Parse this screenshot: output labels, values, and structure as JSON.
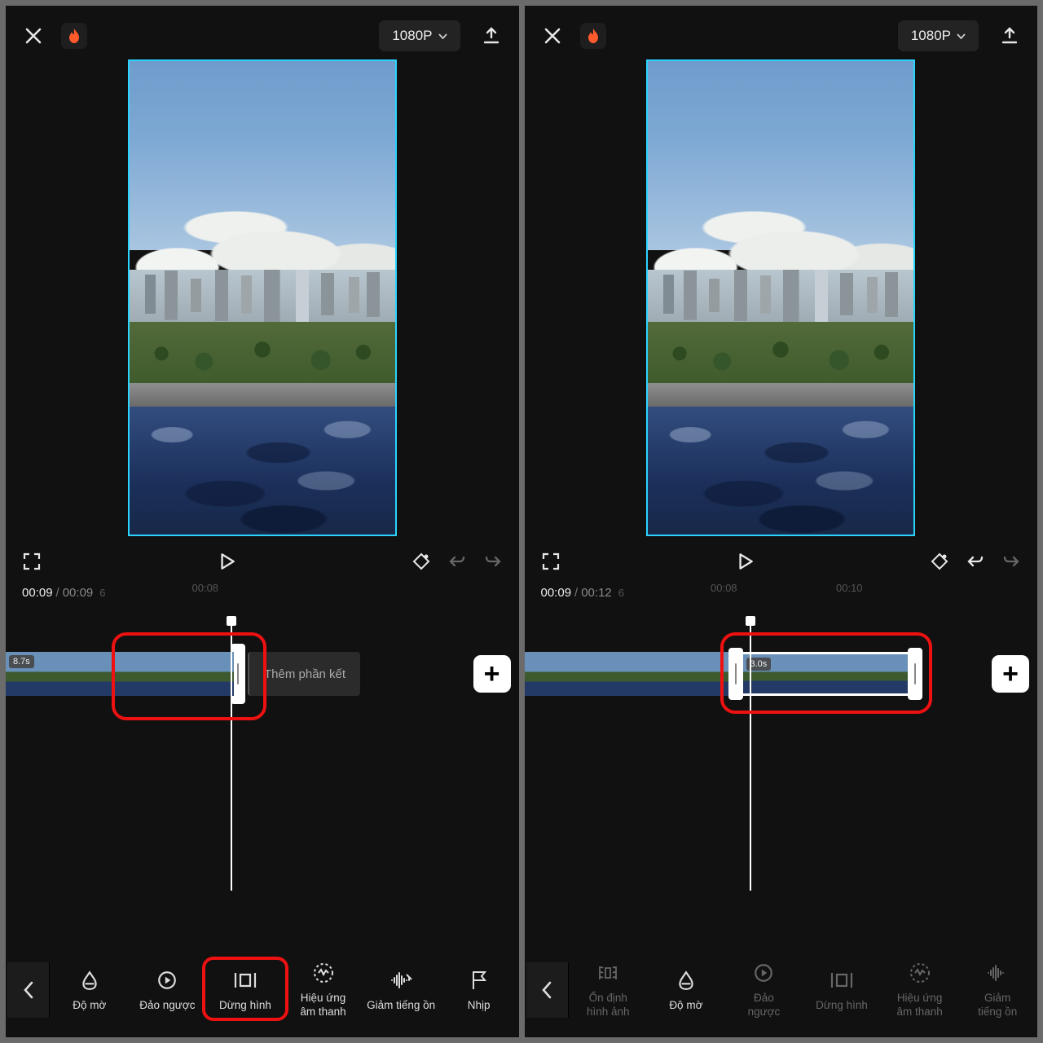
{
  "left": {
    "resolution": "1080P",
    "time_current": "00:09",
    "time_total": "00:09",
    "ticks": [
      "6",
      "00:08"
    ],
    "clip_duration": "8.7s",
    "ending_label": "Thêm phần kết",
    "tools": [
      {
        "label": "Độ mờ"
      },
      {
        "label": "Đảo ngược"
      },
      {
        "label": "Dừng hình"
      },
      {
        "label": "Hiệu ứng\nâm thanh"
      },
      {
        "label": "Giảm tiếng ồn"
      },
      {
        "label": "Nhịp"
      }
    ]
  },
  "right": {
    "resolution": "1080P",
    "time_current": "00:09",
    "time_total": "00:12",
    "ticks": [
      "6",
      "00:08",
      "00:10"
    ],
    "clip_duration": "3.0s",
    "tools": [
      {
        "label": "Ổn định\nhình ảnh"
      },
      {
        "label": "Độ mờ"
      },
      {
        "label": "Đảo\nngược"
      },
      {
        "label": "Dừng hình"
      },
      {
        "label": "Hiệu ứng\nâm thanh"
      },
      {
        "label": "Giảm\ntiếng ồn"
      }
    ]
  }
}
